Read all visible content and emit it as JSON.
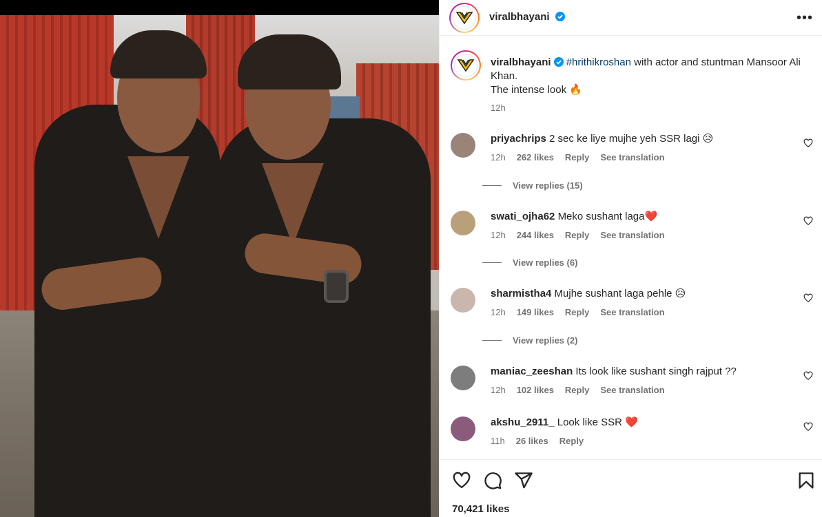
{
  "post": {
    "author": "viralbhayani",
    "caption": {
      "hashtag": "#hrithikroshan",
      "line1_rest": " with actor and stuntman Mansoor Ali Khan.",
      "line2": "The intense look 🔥",
      "time": "12h"
    }
  },
  "comments": [
    {
      "user": "priyachrips",
      "text": "2 sec ke liye mujhe yeh SSR lagi 😥",
      "time": "12h",
      "likes": "262 likes",
      "reply": "Reply",
      "translate": "See translation",
      "view_replies": "View replies (15)",
      "avatar_color": "#9a8377"
    },
    {
      "user": "swati_ojha62",
      "text": "Meko sushant laga❤️",
      "time": "12h",
      "likes": "244 likes",
      "reply": "Reply",
      "translate": "See translation",
      "view_replies": "View replies (6)",
      "avatar_color": "#b9a07b"
    },
    {
      "user": "sharmistha4",
      "text": "Mujhe sushant laga pehle 😥",
      "time": "12h",
      "likes": "149 likes",
      "reply": "Reply",
      "translate": "See translation",
      "view_replies": "View replies (2)",
      "avatar_color": "#c9b6ad"
    },
    {
      "user": "maniac_zeeshan",
      "text": "Its look like sushant singh rajput ??",
      "time": "12h",
      "likes": "102 likes",
      "reply": "Reply",
      "translate": "See translation",
      "view_replies": "",
      "avatar_color": "#7d7d7d"
    },
    {
      "user": "akshu_2911_",
      "text": "Look like SSR ❤️",
      "time": "11h",
      "likes": "26 likes",
      "reply": "Reply",
      "translate": "",
      "view_replies": "",
      "avatar_color": "#8b5b7b"
    }
  ],
  "footer": {
    "likes": "70,421 likes"
  },
  "colors": {
    "link": "#00376b",
    "verified": "#0095f6",
    "muted": "#737373"
  },
  "icons": [
    "verified-badge-icon",
    "more-options-icon",
    "heart-icon",
    "comment-icon",
    "share-icon",
    "bookmark-icon"
  ]
}
